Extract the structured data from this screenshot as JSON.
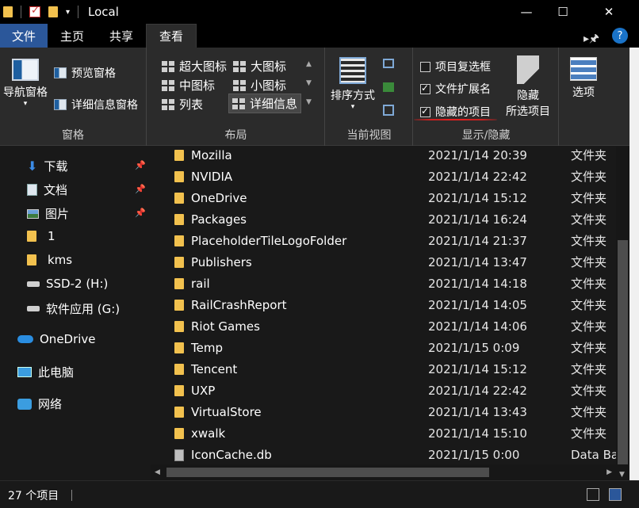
{
  "window": {
    "title": "Local"
  },
  "tabs": {
    "file": "文件",
    "home": "主页",
    "share": "共享",
    "view": "查看"
  },
  "ribbon": {
    "panes": {
      "nav_pane": "导航窗格",
      "preview_pane": "预览窗格",
      "details_pane": "详细信息窗格",
      "label": "窗格"
    },
    "layout": {
      "extra_large": "超大图标",
      "large": "大图标",
      "medium": "中图标",
      "small": "小图标",
      "list": "列表",
      "details": "详细信息",
      "label": "布局"
    },
    "current_view": {
      "sort_by": "排序方式",
      "label": "当前视图"
    },
    "show_hide": {
      "item_checkboxes": "项目复选框",
      "file_extensions": "文件扩展名",
      "hidden_items": "隐藏的项目",
      "hide_selected_1": "隐藏",
      "hide_selected_2": "所选项目",
      "label": "显示/隐藏",
      "item_checkboxes_checked": false,
      "file_extensions_checked": true,
      "hidden_items_checked": true
    },
    "options": "选项"
  },
  "nav": [
    {
      "label": "下载",
      "icon": "download-arrow-icon",
      "pinned": true
    },
    {
      "label": "文档",
      "icon": "document-icon",
      "pinned": true
    },
    {
      "label": "图片",
      "icon": "picture-icon",
      "pinned": true
    },
    {
      "label": "1",
      "icon": "folder-icon"
    },
    {
      "label": "kms",
      "icon": "folder-icon"
    },
    {
      "label": "SSD-2 (H:)",
      "icon": "drive-icon"
    },
    {
      "label": "软件应用 (G:)",
      "icon": "drive-icon"
    },
    {
      "label": "OneDrive",
      "icon": "cloud-icon"
    },
    {
      "label": "此电脑",
      "icon": "computer-icon"
    },
    {
      "label": "网络",
      "icon": "network-icon"
    }
  ],
  "files": [
    {
      "name": "Mozilla",
      "date": "2021/1/14 20:39",
      "type": "文件夹"
    },
    {
      "name": "NVIDIA",
      "date": "2021/1/14 22:42",
      "type": "文件夹"
    },
    {
      "name": "OneDrive",
      "date": "2021/1/14 15:12",
      "type": "文件夹"
    },
    {
      "name": "Packages",
      "date": "2021/1/14 16:24",
      "type": "文件夹"
    },
    {
      "name": "PlaceholderTileLogoFolder",
      "date": "2021/1/14 21:37",
      "type": "文件夹"
    },
    {
      "name": "Publishers",
      "date": "2021/1/14 13:47",
      "type": "文件夹"
    },
    {
      "name": "rail",
      "date": "2021/1/14 14:18",
      "type": "文件夹"
    },
    {
      "name": "RailCrashReport",
      "date": "2021/1/14 14:05",
      "type": "文件夹"
    },
    {
      "name": "Riot Games",
      "date": "2021/1/14 14:06",
      "type": "文件夹"
    },
    {
      "name": "Temp",
      "date": "2021/1/15 0:09",
      "type": "文件夹"
    },
    {
      "name": "Tencent",
      "date": "2021/1/14 15:12",
      "type": "文件夹"
    },
    {
      "name": "UXP",
      "date": "2021/1/14 22:42",
      "type": "文件夹"
    },
    {
      "name": "VirtualStore",
      "date": "2021/1/14 13:43",
      "type": "文件夹"
    },
    {
      "name": "xwalk",
      "date": "2021/1/14 15:10",
      "type": "文件夹"
    },
    {
      "name": "IconCache.db",
      "date": "2021/1/15 0:00",
      "type": "Data Bas"
    }
  ],
  "status": {
    "count": "27 个项目"
  },
  "colors": {
    "accent": "#2b579a",
    "annotation": "#e0201f",
    "folder": "#f2c14e"
  }
}
